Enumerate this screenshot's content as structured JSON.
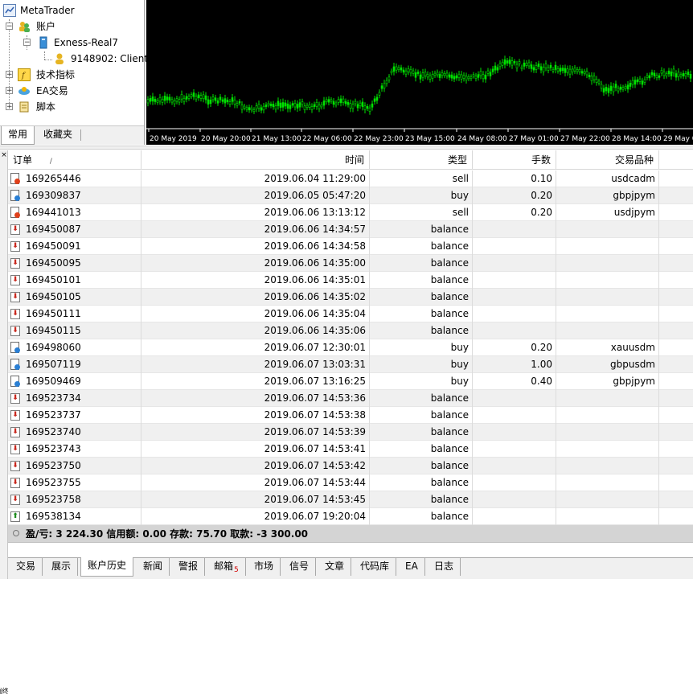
{
  "navigator": {
    "root": "MetaTrader",
    "accounts_label": "账户",
    "server_label": "Exness-Real7",
    "client_label": "9148902: Client",
    "indicators_label": "技术指标",
    "ea_label": "EA交易",
    "scripts_label": "脚本",
    "tabs": [
      "常用",
      "收藏夹"
    ]
  },
  "chart": {
    "x_labels": [
      "20 May 2019",
      "20 May 20:00",
      "21 May 13:00",
      "22 May 06:00",
      "22 May 23:00",
      "23 May 15:00",
      "24 May 08:00",
      "27 May 01:00",
      "27 May 22:00",
      "28 May 14:00",
      "29 May 0"
    ],
    "colors": {
      "background": "#000000",
      "candle": "#00e000",
      "grid_text": "#ffffff"
    }
  },
  "terminal": {
    "columns": [
      "订单",
      "/",
      "时间",
      "类型",
      "手数",
      "交易品种"
    ],
    "rows": [
      {
        "order": "169265446",
        "time": "2019.06.04 11:29:00",
        "type": "sell",
        "lots": "0.10",
        "symbol": "usdcadm",
        "icon": "trade-sell"
      },
      {
        "order": "169309837",
        "time": "2019.06.05 05:47:20",
        "type": "buy",
        "lots": "0.20",
        "symbol": "gbpjpym",
        "icon": "trade-buy"
      },
      {
        "order": "169441013",
        "time": "2019.06.06 13:13:12",
        "type": "sell",
        "lots": "0.20",
        "symbol": "usdjpym",
        "icon": "trade-sell"
      },
      {
        "order": "169450087",
        "time": "2019.06.06 14:34:57",
        "type": "balance",
        "lots": "",
        "symbol": "",
        "icon": "withdrawal"
      },
      {
        "order": "169450091",
        "time": "2019.06.06 14:34:58",
        "type": "balance",
        "lots": "",
        "symbol": "",
        "icon": "withdrawal"
      },
      {
        "order": "169450095",
        "time": "2019.06.06 14:35:00",
        "type": "balance",
        "lots": "",
        "symbol": "",
        "icon": "withdrawal"
      },
      {
        "order": "169450101",
        "time": "2019.06.06 14:35:01",
        "type": "balance",
        "lots": "",
        "symbol": "",
        "icon": "withdrawal"
      },
      {
        "order": "169450105",
        "time": "2019.06.06 14:35:02",
        "type": "balance",
        "lots": "",
        "symbol": "",
        "icon": "withdrawal"
      },
      {
        "order": "169450111",
        "time": "2019.06.06 14:35:04",
        "type": "balance",
        "lots": "",
        "symbol": "",
        "icon": "withdrawal"
      },
      {
        "order": "169450115",
        "time": "2019.06.06 14:35:06",
        "type": "balance",
        "lots": "",
        "symbol": "",
        "icon": "withdrawal"
      },
      {
        "order": "169498060",
        "time": "2019.06.07 12:30:01",
        "type": "buy",
        "lots": "0.20",
        "symbol": "xauusdm",
        "icon": "trade-buy"
      },
      {
        "order": "169507119",
        "time": "2019.06.07 13:03:31",
        "type": "buy",
        "lots": "1.00",
        "symbol": "gbpusdm",
        "icon": "trade-buy"
      },
      {
        "order": "169509469",
        "time": "2019.06.07 13:16:25",
        "type": "buy",
        "lots": "0.40",
        "symbol": "gbpjpym",
        "icon": "trade-buy"
      },
      {
        "order": "169523734",
        "time": "2019.06.07 14:53:36",
        "type": "balance",
        "lots": "",
        "symbol": "",
        "icon": "withdrawal"
      },
      {
        "order": "169523737",
        "time": "2019.06.07 14:53:38",
        "type": "balance",
        "lots": "",
        "symbol": "",
        "icon": "withdrawal"
      },
      {
        "order": "169523740",
        "time": "2019.06.07 14:53:39",
        "type": "balance",
        "lots": "",
        "symbol": "",
        "icon": "withdrawal"
      },
      {
        "order": "169523743",
        "time": "2019.06.07 14:53:41",
        "type": "balance",
        "lots": "",
        "symbol": "",
        "icon": "withdrawal"
      },
      {
        "order": "169523750",
        "time": "2019.06.07 14:53:42",
        "type": "balance",
        "lots": "",
        "symbol": "",
        "icon": "withdrawal"
      },
      {
        "order": "169523755",
        "time": "2019.06.07 14:53:44",
        "type": "balance",
        "lots": "",
        "symbol": "",
        "icon": "withdrawal"
      },
      {
        "order": "169523758",
        "time": "2019.06.07 14:53:45",
        "type": "balance",
        "lots": "",
        "symbol": "",
        "icon": "withdrawal"
      },
      {
        "order": "169538134",
        "time": "2019.06.07 19:20:04",
        "type": "balance",
        "lots": "",
        "symbol": "",
        "icon": "deposit"
      }
    ],
    "summary": "盈/亏: 3 224.30  信用额: 0.00  存款: 75.70  取款: -3 300.00",
    "side_label": "终端",
    "tabs": [
      {
        "label": "交易"
      },
      {
        "label": "展示"
      },
      {
        "label": "账户历史",
        "active": true
      },
      {
        "label": "新闻"
      },
      {
        "label": "警报"
      },
      {
        "label": "邮箱",
        "badge": "5"
      },
      {
        "label": "市场"
      },
      {
        "label": "信号"
      },
      {
        "label": "文章"
      },
      {
        "label": "代码库"
      },
      {
        "label": "EA"
      },
      {
        "label": "日志"
      }
    ]
  }
}
